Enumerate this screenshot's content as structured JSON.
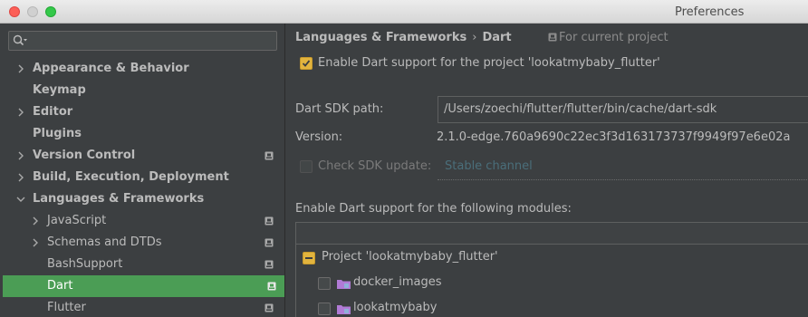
{
  "window": {
    "title": "Preferences"
  },
  "search": {
    "placeholder": ""
  },
  "sidebar": {
    "items": [
      {
        "label": "Appearance & Behavior",
        "expandable": true,
        "level": 0,
        "bold": true
      },
      {
        "label": "Keymap",
        "expandable": false,
        "level": 0,
        "bold": true
      },
      {
        "label": "Editor",
        "expandable": true,
        "level": 0,
        "bold": true
      },
      {
        "label": "Plugins",
        "expandable": false,
        "level": 0,
        "bold": true
      },
      {
        "label": "Version Control",
        "expandable": true,
        "level": 0,
        "bold": true,
        "project_icon": true
      },
      {
        "label": "Build, Execution, Deployment",
        "expandable": true,
        "level": 0,
        "bold": true
      },
      {
        "label": "Languages & Frameworks",
        "expandable": true,
        "expanded": true,
        "level": 0,
        "bold": true
      },
      {
        "label": "JavaScript",
        "expandable": true,
        "level": 1,
        "project_icon": true
      },
      {
        "label": "Schemas and DTDs",
        "expandable": true,
        "level": 1,
        "project_icon": true
      },
      {
        "label": "BashSupport",
        "expandable": false,
        "level": 1,
        "project_icon": true
      },
      {
        "label": "Dart",
        "expandable": false,
        "level": 1,
        "project_icon": true,
        "selected": true
      },
      {
        "label": "Flutter",
        "expandable": false,
        "level": 1,
        "project_icon": true
      }
    ]
  },
  "breadcrumb": {
    "section": "Languages & Frameworks",
    "separator": "›",
    "page": "Dart",
    "scope": "For current project"
  },
  "dart": {
    "enable_label": "Enable Dart support for the project 'lookatmybaby_flutter'",
    "enable_checked": true,
    "sdk_path_label": "Dart SDK path:",
    "sdk_path_value": "/Users/zoechi/flutter/flutter/bin/cache/dart-sdk",
    "version_label": "Version:",
    "version_value": "2.1.0-edge.760a9690c22ec3f3d163173737f9949f97e6e02a",
    "check_update_label": "Check SDK update:",
    "check_update_checked": false,
    "channel_value": "Stable channel",
    "modules_label": "Enable Dart support for the following modules:"
  },
  "modules": {
    "project": {
      "label": "Project 'lookatmybaby_flutter'",
      "state": "partial"
    },
    "items": [
      {
        "label": "docker_images",
        "checked": false
      },
      {
        "label": "lookatmybaby",
        "checked": false
      }
    ]
  },
  "colors": {
    "selection": "#4b9d55",
    "checkbox_accent": "#e2b43e",
    "folder": "#b17bd6",
    "background": "#3c3f41"
  }
}
